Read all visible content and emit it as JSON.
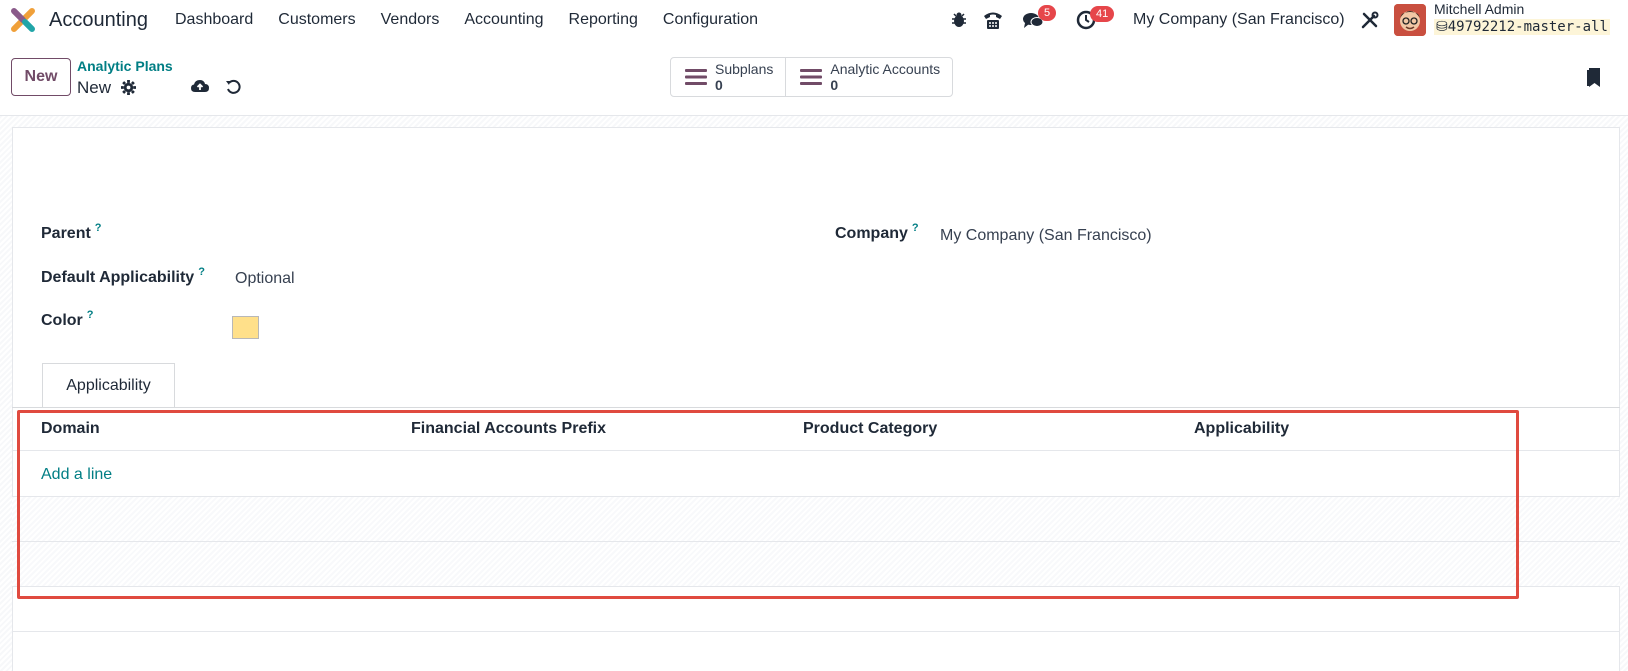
{
  "topnav": {
    "app_name": "Accounting",
    "menu": [
      "Dashboard",
      "Customers",
      "Vendors",
      "Accounting",
      "Reporting",
      "Configuration"
    ],
    "messages_badge": "5",
    "activities_badge": "41",
    "company": "My Company (San Francisco)",
    "user_name": "Mitchell Admin",
    "database": "49792212-master-all"
  },
  "control": {
    "new_label": "New",
    "breadcrumb": "Analytic Plans",
    "record_name": "New",
    "smart_buttons": [
      {
        "label": "Subplans",
        "value": "0"
      },
      {
        "label": "Analytic Accounts",
        "value": "0"
      }
    ]
  },
  "form": {
    "parent_label": "Parent",
    "company_label": "Company",
    "company_value": "My Company (San Francisco)",
    "default_applicability_label": "Default Applicability",
    "default_applicability_value": "Optional",
    "color_label": "Color",
    "color_value": "#ffe08a",
    "help_mark": "?"
  },
  "tabs": {
    "applicability": "Applicability"
  },
  "table": {
    "columns": [
      "Domain",
      "Financial Accounts Prefix",
      "Product Category",
      "Applicability"
    ],
    "add_line": "Add a line"
  },
  "colors": {
    "brand": "#714b67",
    "link": "#017e84",
    "highlight": "#e04a3f"
  }
}
